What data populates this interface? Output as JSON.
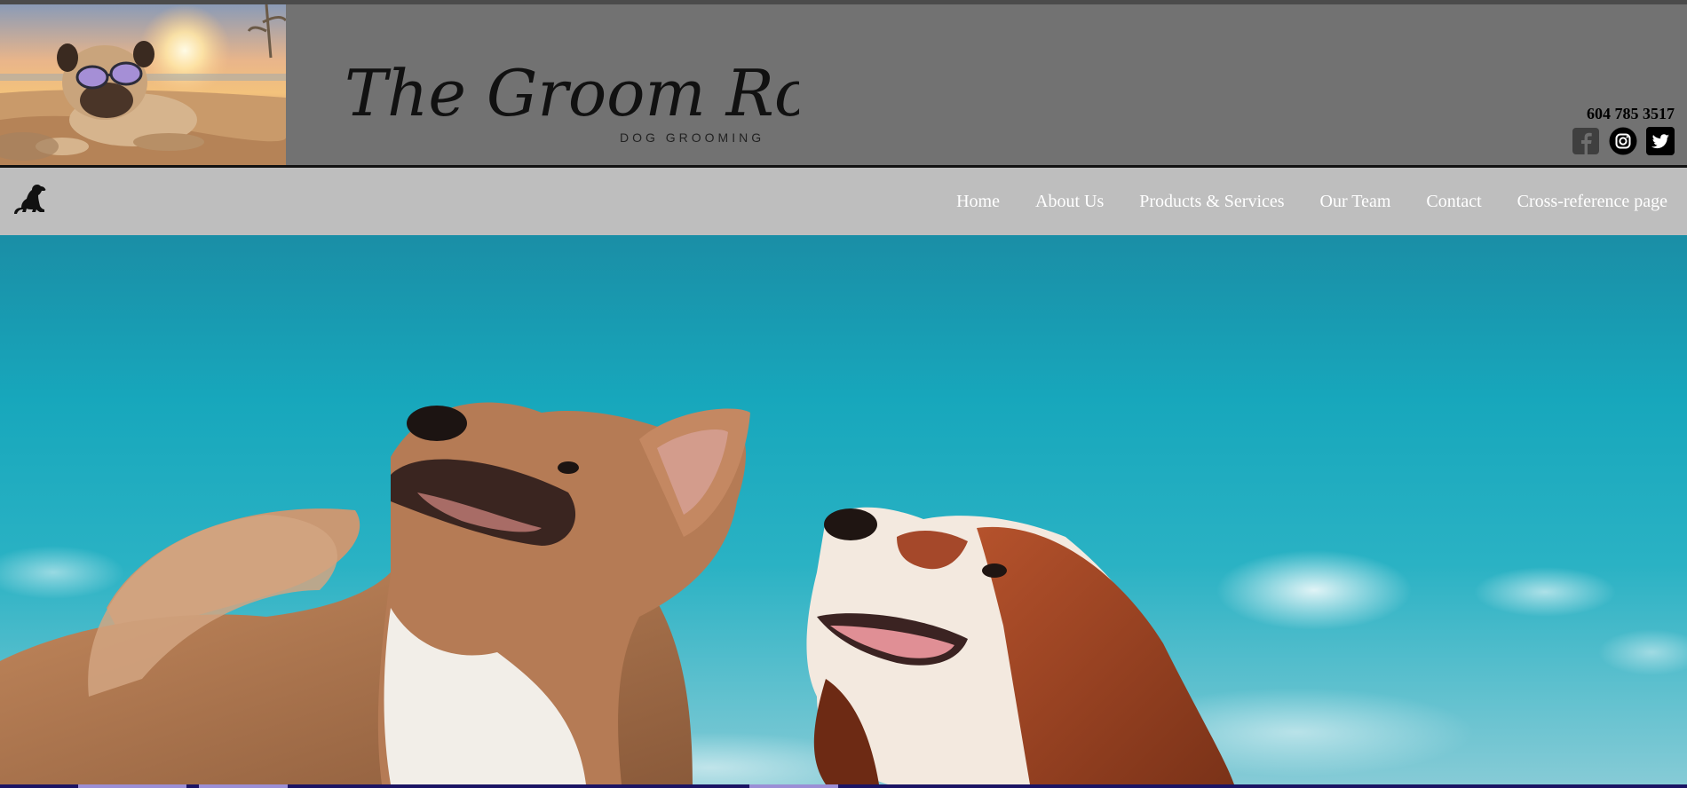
{
  "header": {
    "logo_title": "The Groom Room",
    "logo_subtitle": "DOG GROOMING",
    "phone": "604 785 3517",
    "socials": [
      {
        "name": "facebook-icon"
      },
      {
        "name": "instagram-icon"
      },
      {
        "name": "twitter-icon"
      }
    ]
  },
  "nav": {
    "items": [
      {
        "label": "Home"
      },
      {
        "label": "About Us"
      },
      {
        "label": "Products & Services"
      },
      {
        "label": "Our Team"
      },
      {
        "label": "Contact"
      },
      {
        "label": "Cross-reference page"
      }
    ]
  },
  "colors": {
    "header_bg": "#727272",
    "nav_bg": "#bebebe",
    "nav_text": "#ffffff",
    "sky": "#19a5ba",
    "bottom_strip": "#1b1464"
  }
}
